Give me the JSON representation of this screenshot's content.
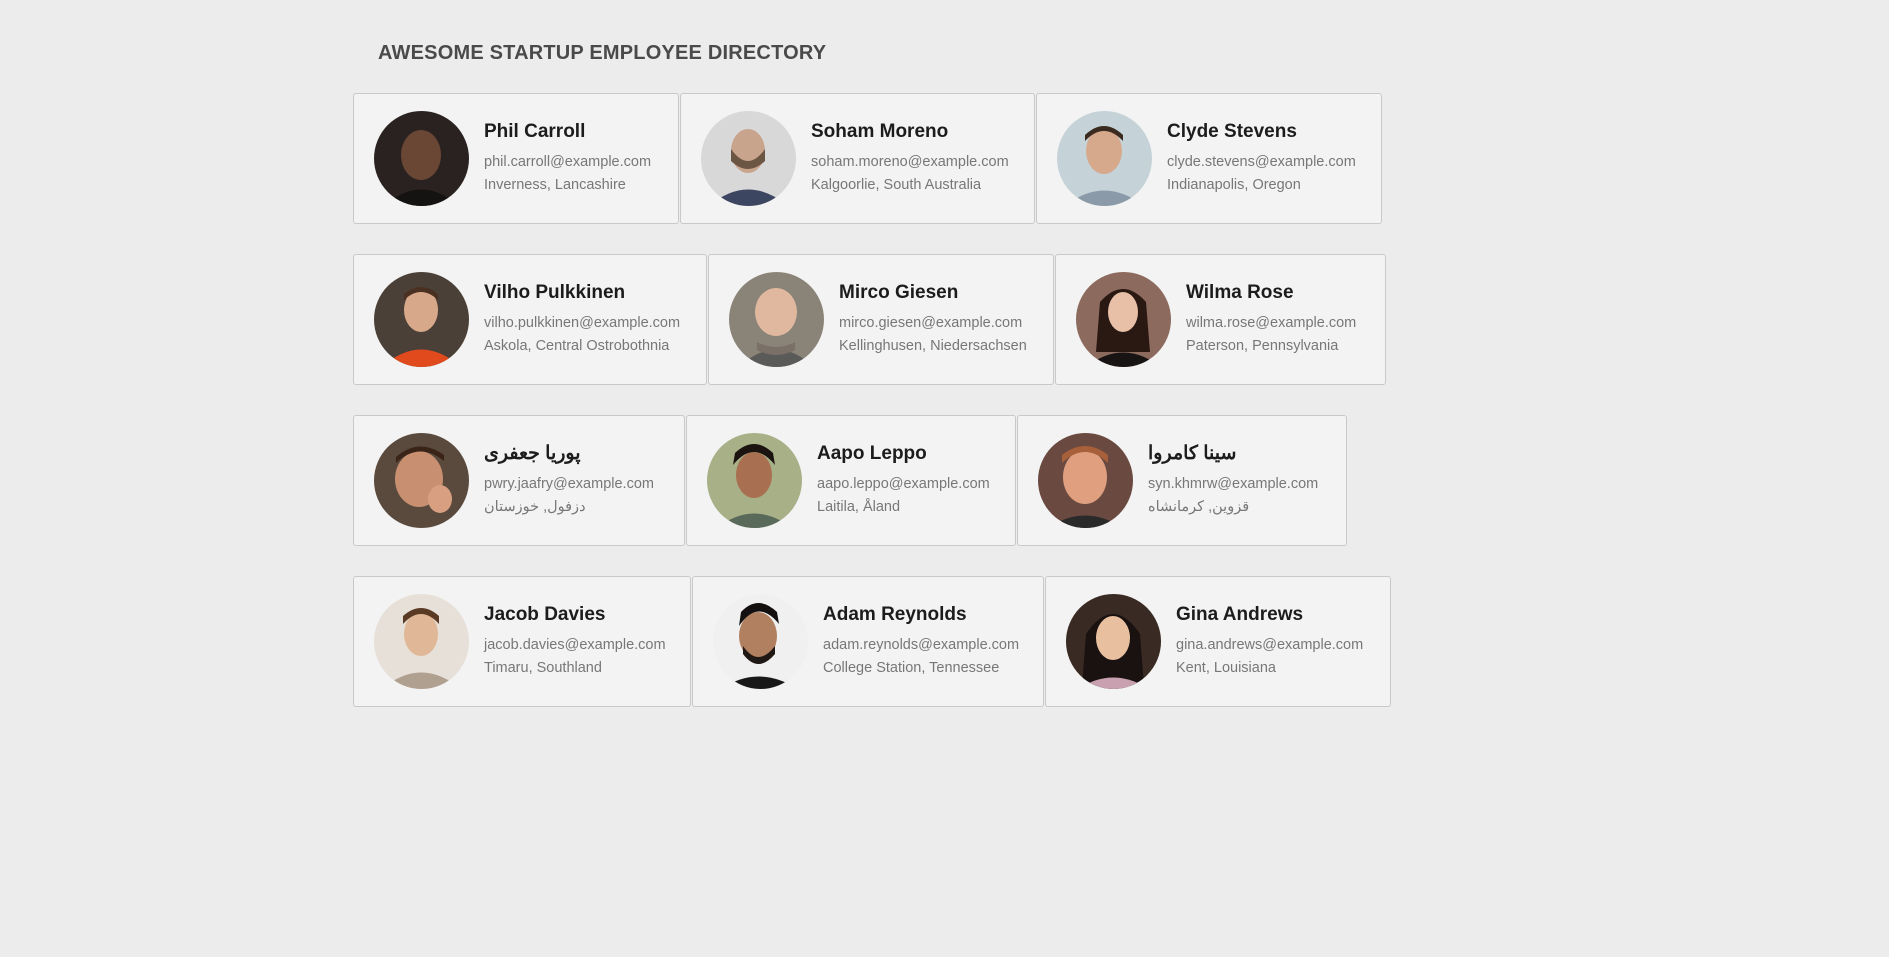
{
  "header": {
    "title": "AWESOME STARTUP EMPLOYEE DIRECTORY"
  },
  "employees": [
    {
      "name": "Phil Carroll",
      "email": "phil.carroll@example.com",
      "location": "Inverness, Lancashire",
      "photo": "portrait-photo"
    },
    {
      "name": "Soham Moreno",
      "email": "soham.moreno@example.com",
      "location": "Kalgoorlie, South Australia",
      "photo": "portrait-photo"
    },
    {
      "name": "Clyde Stevens",
      "email": "clyde.stevens@example.com",
      "location": "Indianapolis, Oregon",
      "photo": "portrait-photo"
    },
    {
      "name": "Vilho Pulkkinen",
      "email": "vilho.pulkkinen@example.com",
      "location": "Askola, Central Ostrobothnia",
      "photo": "portrait-photo"
    },
    {
      "name": "Mirco Giesen",
      "email": "mirco.giesen@example.com",
      "location": "Kellinghusen, Niedersachsen",
      "photo": "portrait-photo"
    },
    {
      "name": "Wilma Rose",
      "email": "wilma.rose@example.com",
      "location": "Paterson, Pennsylvania",
      "photo": "portrait-photo"
    },
    {
      "name": "پوریا جعفری",
      "email": "pwry.jaafry@example.com",
      "location": "دزفول, خوزستان",
      "photo": "portrait-photo"
    },
    {
      "name": "Aapo Leppo",
      "email": "aapo.leppo@example.com",
      "location": "Laitila, Åland",
      "photo": "portrait-photo"
    },
    {
      "name": "سینا کامروا",
      "email": "syn.khmrw@example.com",
      "location": "قزوین, کرمانشاه",
      "photo": "portrait-photo"
    },
    {
      "name": "Jacob Davies",
      "email": "jacob.davies@example.com",
      "location": "Timaru, Southland",
      "photo": "portrait-photo"
    },
    {
      "name": "Adam Reynolds",
      "email": "adam.reynolds@example.com",
      "location": "College Station, Tennessee",
      "photo": "portrait-photo"
    },
    {
      "name": "Gina Andrews",
      "email": "gina.andrews@example.com",
      "location": "Kent, Louisiana",
      "photo": "portrait-photo"
    }
  ],
  "colors": {
    "background": "#ececec",
    "card_background": "#f3f3f3",
    "card_border": "#c9c9c9",
    "name_text": "#1c1c1c",
    "detail_text": "#777777",
    "title_text": "#4a4a4a"
  }
}
